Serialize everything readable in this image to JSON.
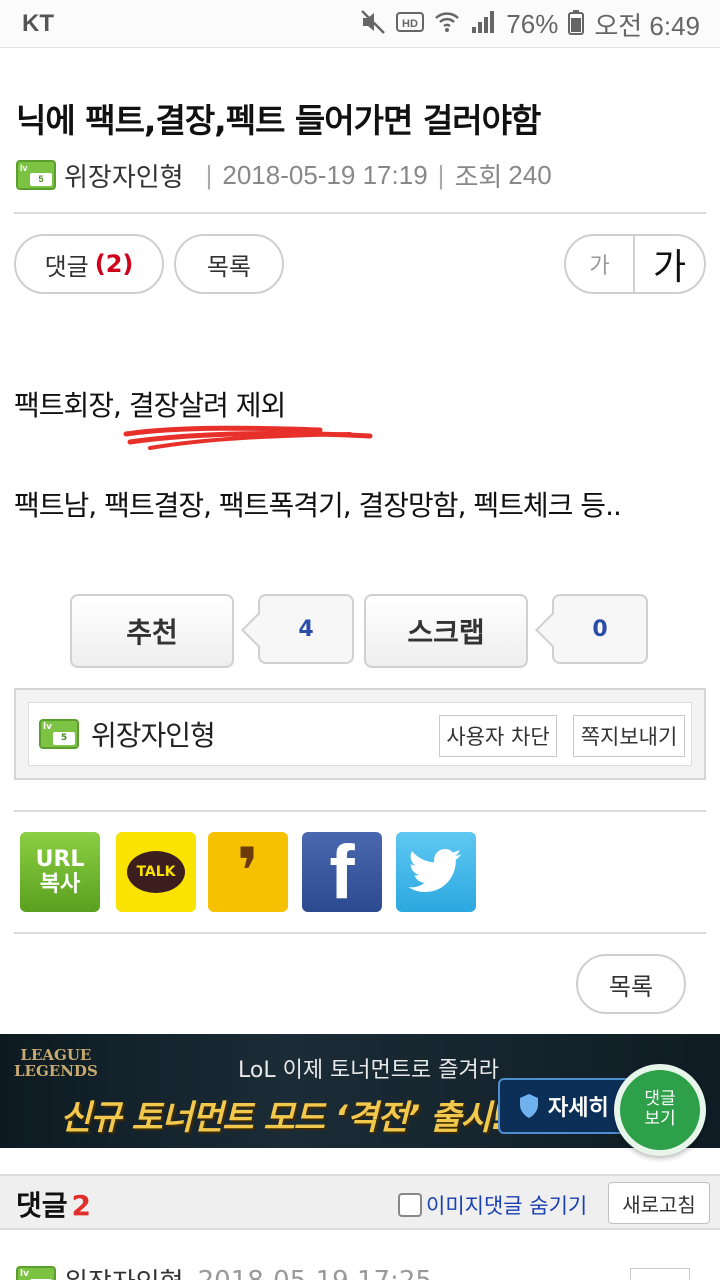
{
  "status_bar": {
    "carrier": "KT",
    "battery": "76%",
    "time": "오전 6:49"
  },
  "post": {
    "title": "닉에 팩트,결장,펙트 들어가면 걸러야함",
    "author": "위장자인형",
    "date": "2018-05-19 17:19",
    "views_label": "조회",
    "views": "240",
    "body_line1": "팩트회장, 결장살려 제외",
    "body_line2": "팩트남, 팩트결장, 팩트폭격기, 결장망함, 펙트체크 등.."
  },
  "toolbar": {
    "comment_label": "댓글",
    "comment_count": "(2)",
    "list_label": "목록",
    "font_small": "가",
    "font_large": "가"
  },
  "recommend": {
    "recommend_label": "추천",
    "recommend_count": "4",
    "scrap_label": "스크랩",
    "scrap_count": "0"
  },
  "author_box": {
    "name": "위장자인형",
    "block_label": "사용자 차단",
    "message_label": "쪽지보내기"
  },
  "share": {
    "url_line1": "URL",
    "url_line2": "복사",
    "talk_label": "TALK",
    "story_glyph": "❜",
    "facebook_glyph": "f",
    "icons": [
      "url-copy-icon",
      "kakaotalk-icon",
      "kakaostory-icon",
      "facebook-icon",
      "twitter-icon"
    ]
  },
  "bottom": {
    "list_label": "목록"
  },
  "banner": {
    "logo_line1": "LEAGUE",
    "logo_line2": "LEGENDS",
    "subtitle": "LoL 이제 토너먼트로 즐겨라",
    "main": "신규 토너먼트 모드 ‘격전’ 출시!",
    "detail_label": "자세히"
  },
  "fab": {
    "line1": "댓글",
    "line2": "보기"
  },
  "comments": {
    "title": "댓글",
    "count": "2",
    "hide_label": "이미지댓글 숨기기",
    "refresh_label": "새로고침",
    "first_author": "위장자인형",
    "first_date": "2018-05-19 17:25"
  },
  "colors": {
    "accent_red": "#d0021b",
    "count_blue": "#2a4ea8",
    "level_green": "#7cc344",
    "fab_green": "#2fa04a"
  }
}
